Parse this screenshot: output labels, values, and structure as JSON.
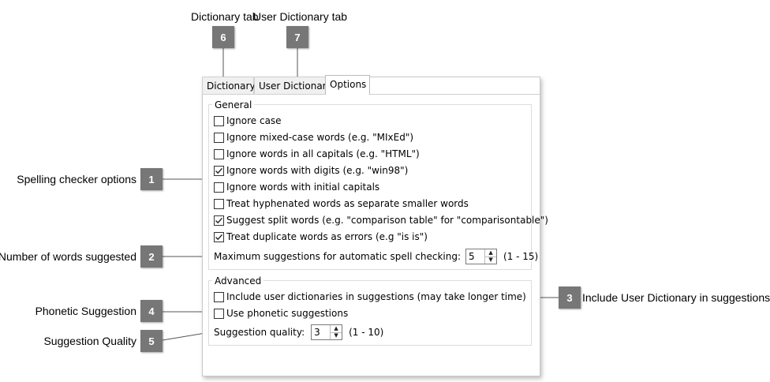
{
  "dialog": {
    "tabs": [
      "Dictionary",
      "User Dictionary",
      "Options"
    ],
    "active_tab": "Options",
    "general": {
      "title": "General",
      "options": [
        {
          "label": "Ignore case",
          "checked": false
        },
        {
          "label": "Ignore mixed-case words (e.g. \"MIxEd\")",
          "checked": false
        },
        {
          "label": "Ignore words in all capitals (e.g. \"HTML\")",
          "checked": false
        },
        {
          "label": "Ignore words with digits (e.g. \"win98\")",
          "checked": true
        },
        {
          "label": "Ignore words with initial capitals",
          "checked": false
        },
        {
          "label": "Treat hyphenated words as separate smaller words",
          "checked": false
        },
        {
          "label": "Suggest split words (e.g. \"comparison table\" for \"comparisontable\")",
          "checked": true
        },
        {
          "label": "Treat duplicate words as errors (e.g \"is is\")",
          "checked": true
        }
      ],
      "max_suggestions": {
        "label": "Maximum suggestions for automatic spell checking:",
        "value": "5",
        "range": "(1 - 15)"
      }
    },
    "advanced": {
      "title": "Advanced",
      "options": [
        {
          "label": "Include user dictionaries in suggestions (may take longer time)",
          "checked": false
        },
        {
          "label": "Use phonetic suggestions",
          "checked": false
        }
      ],
      "quality": {
        "label": "Suggestion quality:",
        "value": "3",
        "range": "(1 - 10)"
      }
    }
  },
  "callouts": [
    {
      "number": "1",
      "label": "Spelling checker options"
    },
    {
      "number": "2",
      "label": "Number of words suggested"
    },
    {
      "number": "3",
      "label": "Include User Dictionary in suggestions"
    },
    {
      "number": "4",
      "label": "Phonetic Suggestion"
    },
    {
      "number": "5",
      "label": "Suggestion Quality"
    },
    {
      "number": "6",
      "label": "Dictionary tab"
    },
    {
      "number": "7",
      "label": "User Dictionary tab"
    }
  ],
  "colors": {
    "badge": "#777777",
    "border": "#c8c8c8",
    "text": "#000000"
  },
  "icons": {
    "check": "check-icon",
    "spin_up": "spin-up-icon",
    "spin_down": "spin-down-icon"
  }
}
